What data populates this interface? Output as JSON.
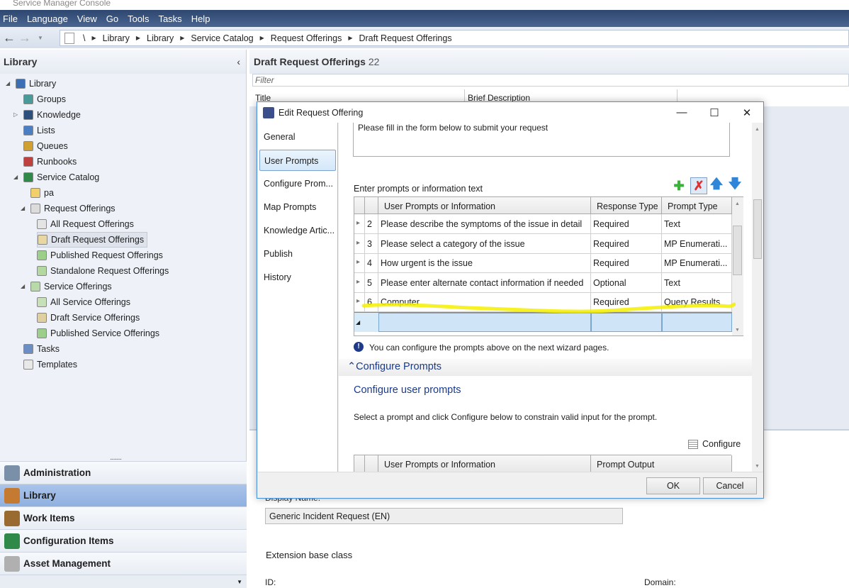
{
  "app": {
    "title": "Service Manager Console"
  },
  "menu": [
    "File",
    "Language",
    "View",
    "Go",
    "Tools",
    "Tasks",
    "Help"
  ],
  "breadcrumb": [
    "\\",
    "Library",
    "Library",
    "Service Catalog",
    "Request Offerings",
    "Draft Request Offerings"
  ],
  "sidebar": {
    "title": "Library",
    "tree": [
      {
        "label": "Library",
        "level": 0,
        "expanded": true,
        "color": "#3a6fb5"
      },
      {
        "label": "Groups",
        "level": 1,
        "color": "#4a9a9a"
      },
      {
        "label": "Knowledge",
        "level": 1,
        "collapsed": true,
        "color": "#2c4f7c"
      },
      {
        "label": "Lists",
        "level": 1,
        "color": "#4b7fc4"
      },
      {
        "label": "Queues",
        "level": 1,
        "color": "#d0a030"
      },
      {
        "label": "Runbooks",
        "level": 1,
        "color": "#c04040"
      },
      {
        "label": "Service Catalog",
        "level": 1,
        "expanded": true,
        "color": "#2f8a4a"
      },
      {
        "label": "pa",
        "level": 2,
        "color": "#f1cf6b"
      },
      {
        "label": "Request Offerings",
        "level": 2,
        "expanded": true,
        "color": "#dcdcdc"
      },
      {
        "label": "All Request Offerings",
        "level": 3,
        "color": "#e4e4e4"
      },
      {
        "label": "Draft Request Offerings",
        "level": 3,
        "selected": true,
        "color": "#e8d7a0"
      },
      {
        "label": "Published Request Offerings",
        "level": 3,
        "color": "#9ccf8a"
      },
      {
        "label": "Standalone Request Offerings",
        "level": 3,
        "color": "#b3d9a0"
      },
      {
        "label": "Service Offerings",
        "level": 2,
        "expanded": true,
        "color": "#b8d9a8"
      },
      {
        "label": "All Service Offerings",
        "level": 3,
        "color": "#c8e0b8"
      },
      {
        "label": "Draft Service Offerings",
        "level": 3,
        "color": "#e0d0a0"
      },
      {
        "label": "Published Service Offerings",
        "level": 3,
        "color": "#9ccf8a"
      },
      {
        "label": "Tasks",
        "level": 1,
        "color": "#6b8fc4"
      },
      {
        "label": "Templates",
        "level": 1,
        "color": "#e8e8e8"
      }
    ],
    "workspaces": [
      {
        "label": "Administration",
        "color": "#7a8fa8"
      },
      {
        "label": "Library",
        "selected": true,
        "color": "#c47a30"
      },
      {
        "label": "Work Items",
        "color": "#9a6b30"
      },
      {
        "label": "Configuration Items",
        "color": "#2f8a4a"
      },
      {
        "label": "Asset Management",
        "color": "#b0b0b0"
      }
    ]
  },
  "main": {
    "title": "Draft Request Offerings",
    "count": "22",
    "filter_placeholder": "Filter",
    "columns": [
      "Title",
      "Brief Description"
    ],
    "details": {
      "display_name_label": "Display Name:",
      "display_name_value": "Generic Incident Request (EN)",
      "extension_label": "Extension base class",
      "id_label": "ID:",
      "domain_label": "Domain:"
    }
  },
  "dialog": {
    "title": "Edit Request Offering",
    "nav": [
      {
        "label": "General"
      },
      {
        "label": "User Prompts",
        "selected": true
      },
      {
        "label": "Configure Prom..."
      },
      {
        "label": "Map Prompts"
      },
      {
        "label": "Knowledge Artic..."
      },
      {
        "label": "Publish"
      },
      {
        "label": "History"
      }
    ],
    "instructions_text": "Please fill in the form below to submit your request",
    "prompts_label": "Enter prompts or information text",
    "grid_headers": [
      "User Prompts or Information",
      "Response Type",
      "Prompt Type"
    ],
    "grid_rows": [
      {
        "num": "2",
        "prompt": "Please describe the symptoms of the issue in detail",
        "response": "Required",
        "type": "Text"
      },
      {
        "num": "3",
        "prompt": "Please select a category of the issue",
        "response": "Required",
        "type": "MP Enumerati..."
      },
      {
        "num": "4",
        "prompt": "How urgent is the issue",
        "response": "Required",
        "type": "MP Enumerati..."
      },
      {
        "num": "5",
        "prompt": "Please enter alternate contact information if needed",
        "response": "Optional",
        "type": "Text"
      },
      {
        "num": "6",
        "prompt": "Computer",
        "response": "Required",
        "type": "Query Results"
      }
    ],
    "info_text": "You can configure the prompts above on the next wizard pages.",
    "section_title": "Configure Prompts",
    "configure_heading": "Configure user prompts",
    "configure_desc": "Select a prompt and click Configure below to constrain valid input for the prompt.",
    "configure_button": "Configure",
    "grid2_headers": [
      "User Prompts or Information",
      "Prompt Output"
    ],
    "ok": "OK",
    "cancel": "Cancel",
    "highlight_color": "#f5f000"
  }
}
